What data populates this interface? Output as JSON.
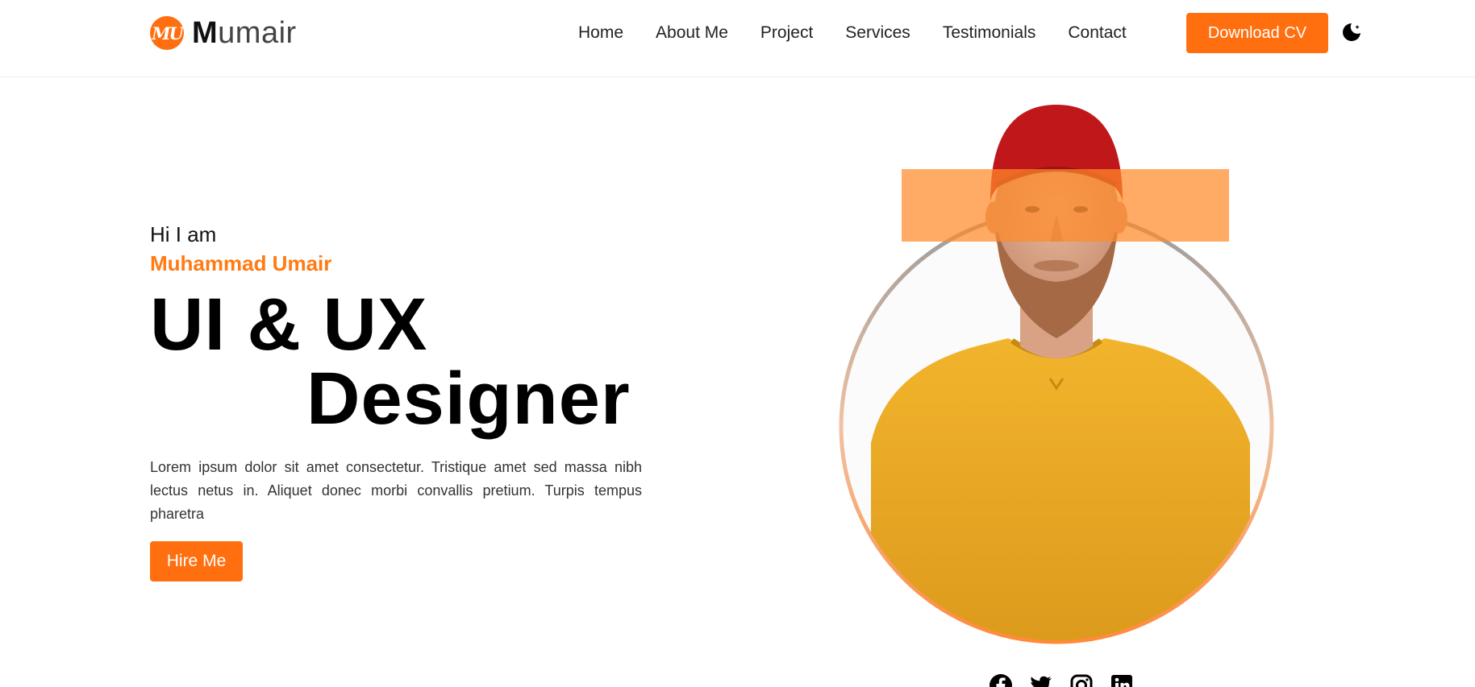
{
  "brand": {
    "logo_mark": "MU",
    "name_initial": "M",
    "name_rest": "umair",
    "accent_color": "#ff6f0f"
  },
  "nav": {
    "items": [
      {
        "label": "Home"
      },
      {
        "label": "About Me"
      },
      {
        "label": "Project"
      },
      {
        "label": "Services"
      },
      {
        "label": "Testimonials"
      },
      {
        "label": "Contact"
      }
    ]
  },
  "header": {
    "cv_button": "Download CV",
    "theme_icon": "moon-icon"
  },
  "hero": {
    "greeting": "Hi I am",
    "name": "Muhammad Umair",
    "title_line1": "UI & UX",
    "title_line2": "Designer",
    "description": "Lorem ipsum dolor sit amet consectetur. Tristique amet sed massa nibh lectus netus in. Aliquet donec morbi convallis pretium. Turpis tempus pharetra",
    "hire_button": "Hire Me"
  },
  "portrait": {
    "subject": "man in red beanie and yellow sweater"
  },
  "social": {
    "icons": [
      "facebook-icon",
      "twitter-icon",
      "instagram-icon",
      "linkedin-icon"
    ]
  }
}
